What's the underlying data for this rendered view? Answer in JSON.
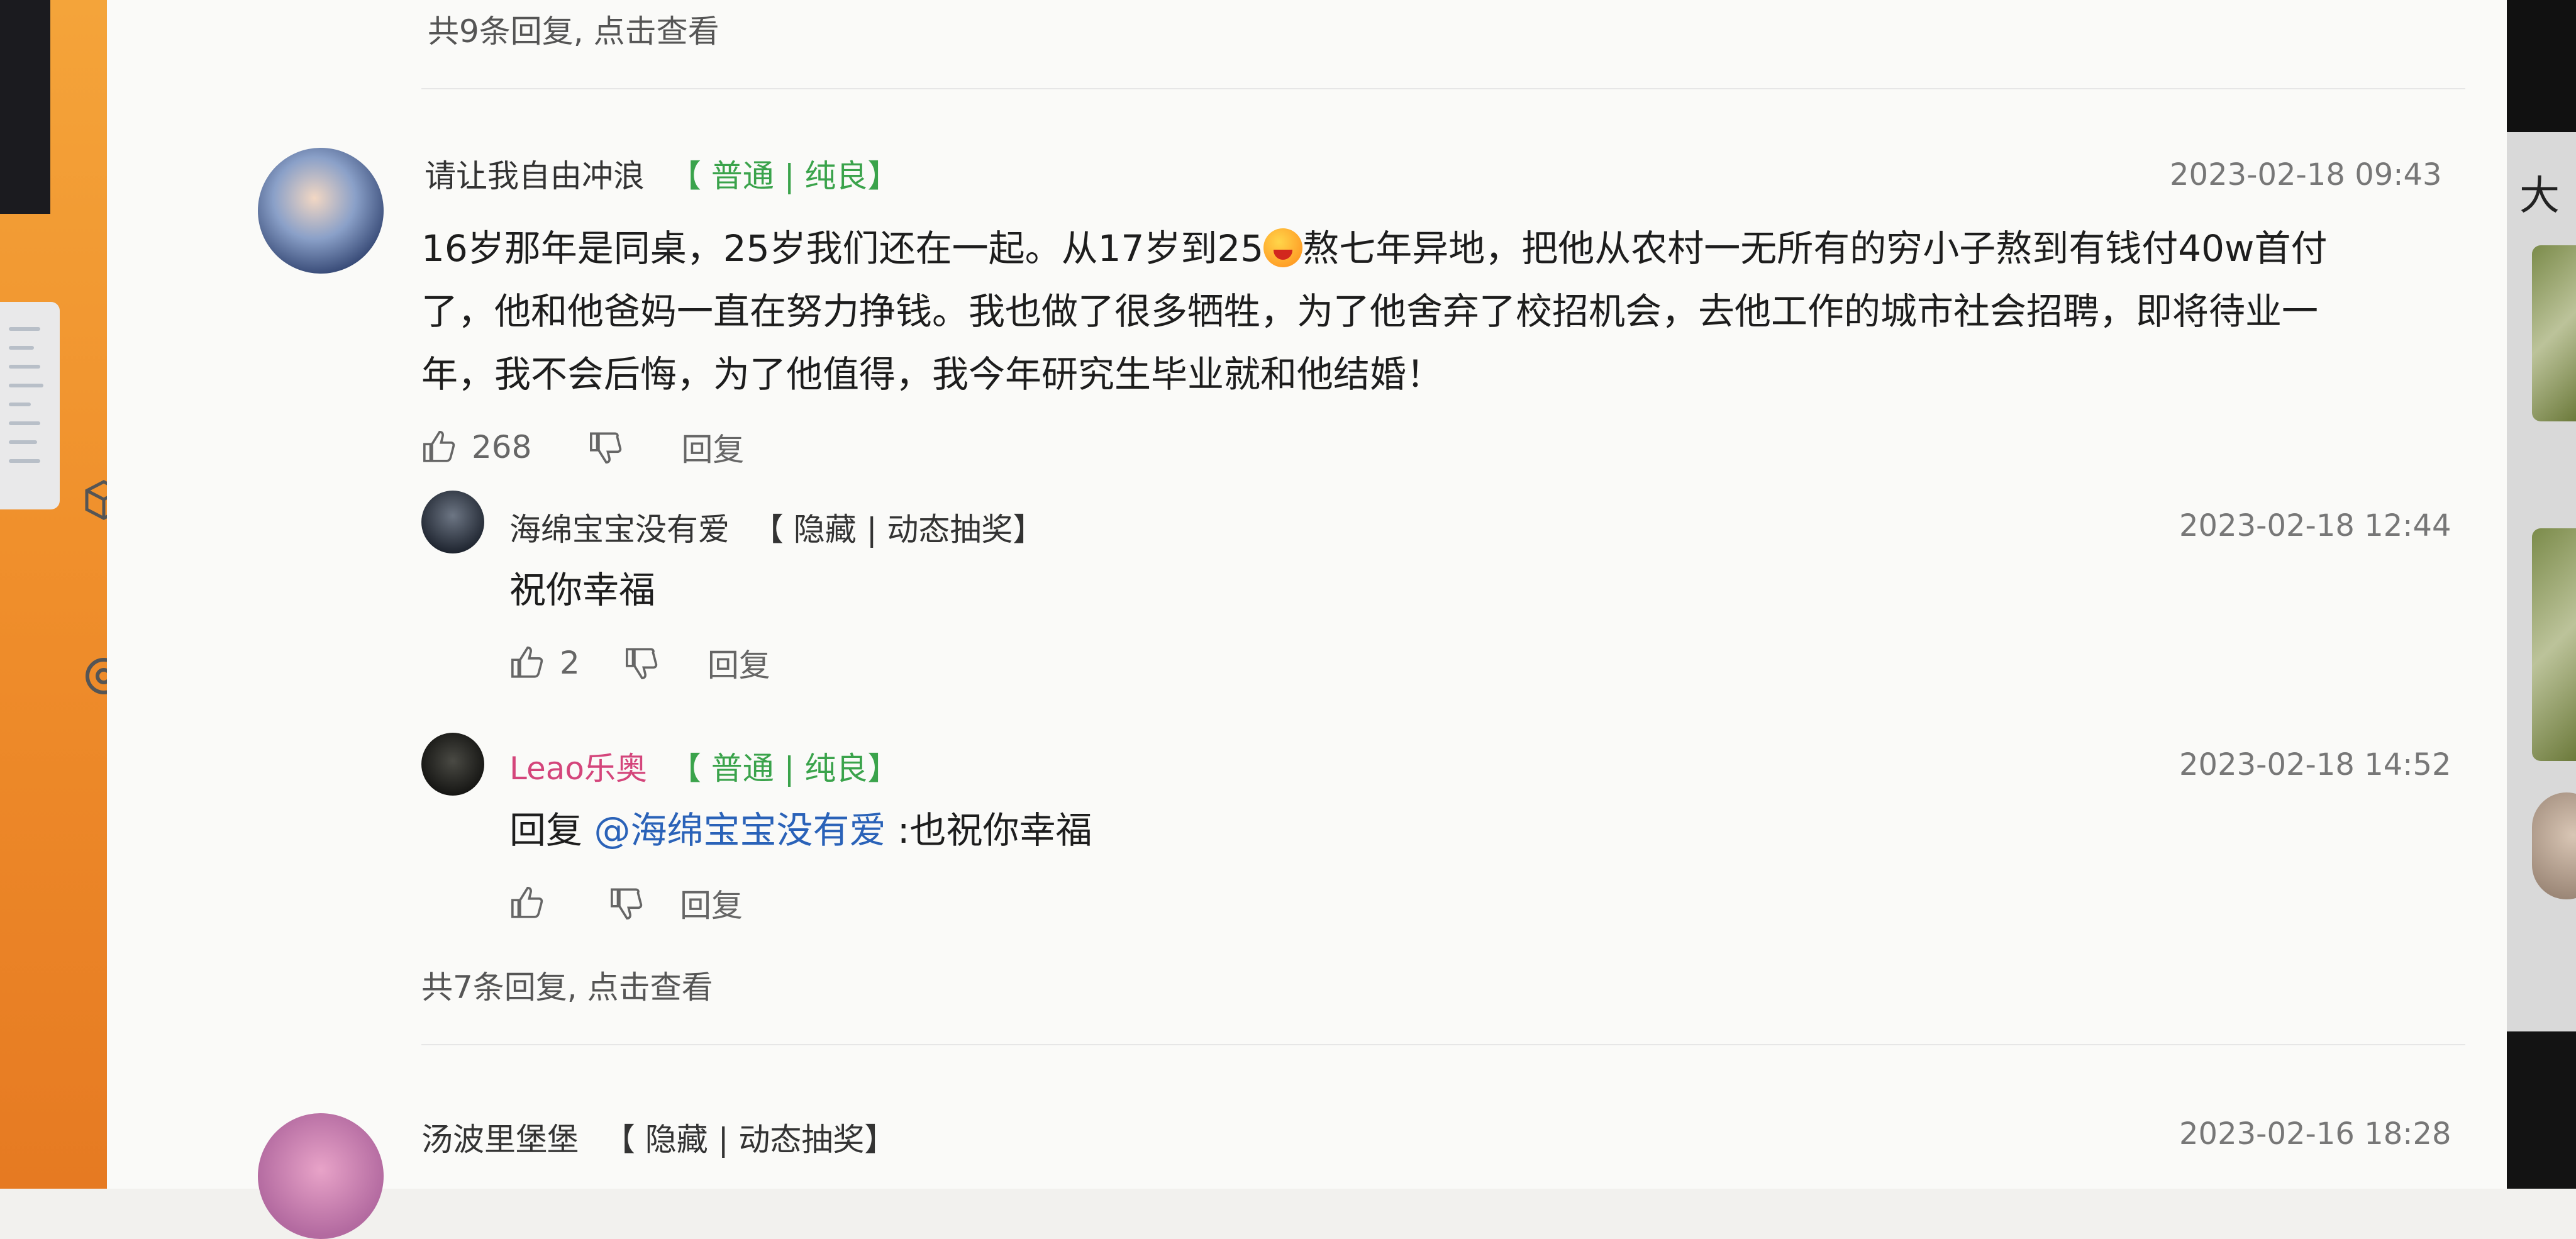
{
  "top_more": "共9条回复, 点击查看",
  "comment1": {
    "user": "请让我自由冲浪",
    "tag": "【 普通 | 纯良】",
    "time": "2023-02-18 09:43",
    "text_l1a": "16岁那年是同桌，25岁我们还在一起。从17岁到25",
    "text_l1b": "熬七年异地，把他从农村一无所有的穷小子熬到有钱付40w首付",
    "text_l2": "了，他和他爸妈一直在努力挣钱。我也做了很多牺牲，为了他舍弃了校招机会，去他工作的城市社会招聘，即将待业一",
    "text_l3": "年，我不会后悔，为了他值得，我今年研究生毕业就和他结婚！",
    "likes": "268",
    "reply_label": "回复"
  },
  "reply1": {
    "user": "海绵宝宝没有爱",
    "tag": "【 隐藏 | 动态抽奖】",
    "time": "2023-02-18 12:44",
    "text": "祝你幸福",
    "likes": "2",
    "reply_label": "回复"
  },
  "reply2": {
    "user": "Leao乐奥",
    "tag": "【 普通 | 纯良】",
    "time": "2023-02-18 14:52",
    "prefix": "回复",
    "mention": "@海绵宝宝没有爱",
    "text": ":也祝你幸福",
    "reply_label": "回复"
  },
  "bottom_more": "共7条回复, 点击查看",
  "comment2": {
    "user": "汤波里堡堡",
    "tag": "【 隐藏 | 动态抽奖】",
    "time": "2023-02-16 18:28"
  },
  "right_edge_char": "大",
  "colors": {
    "tag_green": "#3aa34b",
    "mention_blue": "#2a62b8",
    "pink_name": "#d4457b"
  }
}
